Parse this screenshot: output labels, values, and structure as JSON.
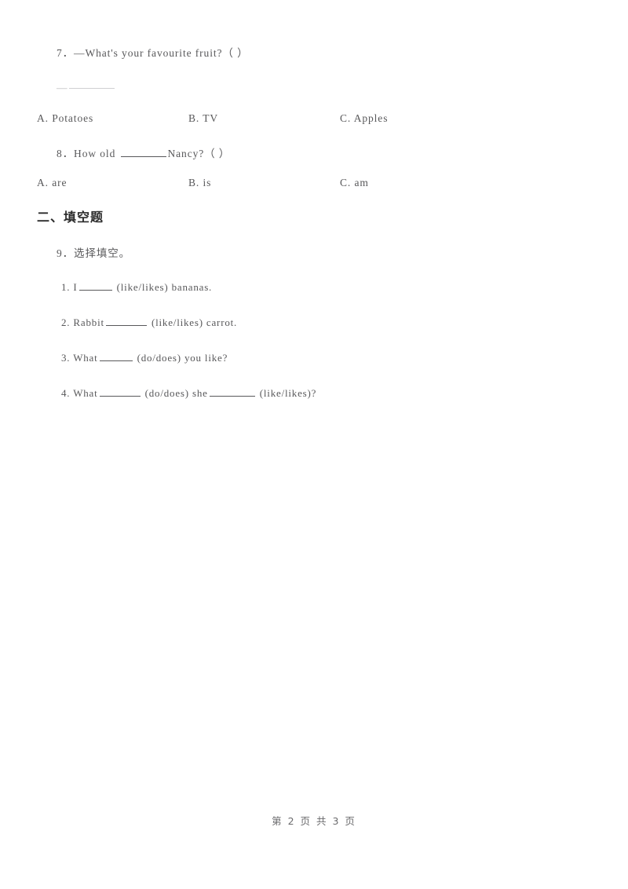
{
  "document": {
    "background_color": "#ffffff",
    "text_color": "#58585a",
    "heading_color": "#2b2b2b"
  },
  "questions": [
    {
      "id": "q7",
      "stem": "7．—What's your favourite fruit?（    ）",
      "answer_stub_dash": "—",
      "options": {
        "a": "A. Potatoes",
        "b": "B. TV",
        "c": "C. Apples"
      }
    },
    {
      "id": "q8",
      "stem_before_blank": "8．How old ",
      "stem_after_blank": "Nancy?（    ）",
      "options": {
        "a": "A. are",
        "b": "B. is",
        "c": "C. am"
      }
    }
  ],
  "section_two": {
    "heading": "二、填空题",
    "prompt": "9．选择填空。",
    "items": [
      {
        "number": "1.",
        "part1": "I",
        "part2": "(like/likes) bananas."
      },
      {
        "number": "2.",
        "part1": "Rabbit",
        "part2": "(like/likes) carrot."
      },
      {
        "number": "3.",
        "part1": "What",
        "part2": "(do/does) you like?"
      },
      {
        "number": "4.",
        "part1": "What",
        "part2": "(do/does) she",
        "part3": "(like/likes)?"
      }
    ]
  },
  "footer": {
    "page_label": "第 2 页 共 3 页"
  }
}
